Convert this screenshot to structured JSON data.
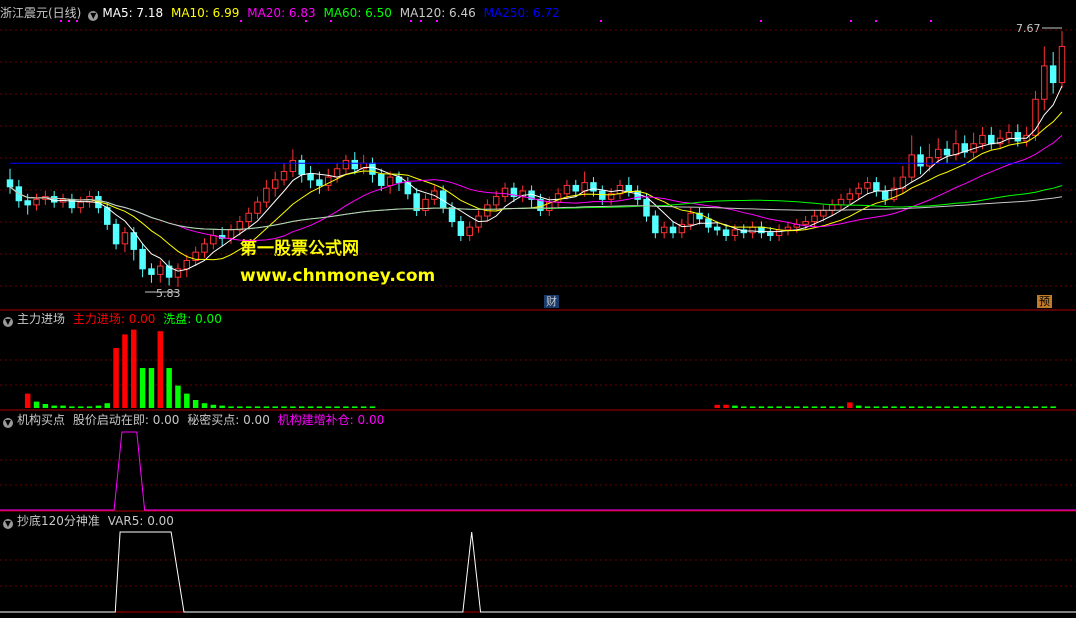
{
  "panel1": {
    "title": "浙江震元(日线)",
    "ma": [
      {
        "label": "MA5: 7.18",
        "color": "#ffffff"
      },
      {
        "label": "MA10: 6.99",
        "color": "#ffff00"
      },
      {
        "label": "MA20: 6.83",
        "color": "#ff00ff"
      },
      {
        "label": "MA60: 6.50",
        "color": "#00ff00"
      },
      {
        "label": "MA120: 6.46",
        "color": "#c8c8c8"
      },
      {
        "label": "MA250: 6.72",
        "color": "#0000ff"
      }
    ],
    "high_label": "7.67",
    "low_label": "5.83",
    "marker_cai": "财",
    "marker_yu": "预",
    "watermark_cn": "第一股票公式网",
    "watermark_url": "www.chnmoney.com"
  },
  "panel2": {
    "title": "主力进场",
    "v1_label": "主力进场: 0.00",
    "v2_label": "洗盘: 0.00",
    "v1_color": "#ff0000",
    "v2_color": "#00ff00"
  },
  "panel3": {
    "title": "机构买点",
    "l1": "股价启动在即: 0.00",
    "l2": "秘密买点: 0.00",
    "l3": "机构建增补仓: 0.00",
    "l3_color": "#ff00ff"
  },
  "panel4": {
    "title": "抄底120分神准",
    "l1": "VAR5: 0.00"
  },
  "chart_data": {
    "type": "candlestick",
    "y_range": [
      5.7,
      7.75
    ],
    "high": 7.67,
    "low": 5.83,
    "candles": [
      [
        6.6,
        6.55,
        6.68,
        6.5
      ],
      [
        6.55,
        6.45,
        6.6,
        6.4
      ],
      [
        6.45,
        6.42,
        6.5,
        6.35
      ],
      [
        6.42,
        6.46,
        6.5,
        6.38
      ],
      [
        6.46,
        6.48,
        6.52,
        6.42
      ],
      [
        6.48,
        6.44,
        6.52,
        6.4
      ],
      [
        6.44,
        6.46,
        6.5,
        6.4
      ],
      [
        6.46,
        6.4,
        6.5,
        6.36
      ],
      [
        6.4,
        6.44,
        6.48,
        6.36
      ],
      [
        6.44,
        6.48,
        6.52,
        6.4
      ],
      [
        6.48,
        6.4,
        6.52,
        6.36
      ],
      [
        6.4,
        6.28,
        6.44,
        6.24
      ],
      [
        6.28,
        6.14,
        6.32,
        6.1
      ],
      [
        6.14,
        6.22,
        6.26,
        6.08
      ],
      [
        6.22,
        6.1,
        6.26,
        6.02
      ],
      [
        6.1,
        5.96,
        6.14,
        5.9
      ],
      [
        5.96,
        5.92,
        6.0,
        5.86
      ],
      [
        5.92,
        5.98,
        6.02,
        5.86
      ],
      [
        5.98,
        5.9,
        6.02,
        5.84
      ],
      [
        5.9,
        5.96,
        6.0,
        5.83
      ],
      [
        5.96,
        6.02,
        6.06,
        5.9
      ],
      [
        6.02,
        6.08,
        6.12,
        5.98
      ],
      [
        6.08,
        6.14,
        6.18,
        6.04
      ],
      [
        6.14,
        6.2,
        6.24,
        6.1
      ],
      [
        6.2,
        6.18,
        6.26,
        6.12
      ],
      [
        6.18,
        6.24,
        6.28,
        6.14
      ],
      [
        6.24,
        6.3,
        6.34,
        6.2
      ],
      [
        6.3,
        6.36,
        6.4,
        6.26
      ],
      [
        6.36,
        6.44,
        6.48,
        6.32
      ],
      [
        6.44,
        6.54,
        6.6,
        6.4
      ],
      [
        6.54,
        6.6,
        6.66,
        6.48
      ],
      [
        6.6,
        6.66,
        6.72,
        6.56
      ],
      [
        6.66,
        6.74,
        6.82,
        6.62
      ],
      [
        6.74,
        6.64,
        6.78,
        6.58
      ],
      [
        6.64,
        6.6,
        6.7,
        6.54
      ],
      [
        6.6,
        6.56,
        6.66,
        6.5
      ],
      [
        6.56,
        6.62,
        6.68,
        6.52
      ],
      [
        6.62,
        6.68,
        6.72,
        6.58
      ],
      [
        6.68,
        6.74,
        6.78,
        6.64
      ],
      [
        6.74,
        6.68,
        6.8,
        6.64
      ],
      [
        6.68,
        6.72,
        6.78,
        6.64
      ],
      [
        6.72,
        6.64,
        6.76,
        6.58
      ],
      [
        6.64,
        6.56,
        6.68,
        6.52
      ],
      [
        6.56,
        6.62,
        6.66,
        6.5
      ],
      [
        6.62,
        6.58,
        6.66,
        6.52
      ],
      [
        6.58,
        6.5,
        6.62,
        6.46
      ],
      [
        6.5,
        6.38,
        6.54,
        6.34
      ],
      [
        6.38,
        6.46,
        6.5,
        6.34
      ],
      [
        6.46,
        6.52,
        6.56,
        6.42
      ],
      [
        6.52,
        6.4,
        6.56,
        6.36
      ],
      [
        6.4,
        6.3,
        6.44,
        6.26
      ],
      [
        6.3,
        6.2,
        6.34,
        6.16
      ],
      [
        6.2,
        6.26,
        6.3,
        6.16
      ],
      [
        6.26,
        6.34,
        6.38,
        6.22
      ],
      [
        6.34,
        6.42,
        6.46,
        6.3
      ],
      [
        6.42,
        6.48,
        6.52,
        6.38
      ],
      [
        6.48,
        6.54,
        6.58,
        6.44
      ],
      [
        6.54,
        6.48,
        6.58,
        6.44
      ],
      [
        6.48,
        6.52,
        6.56,
        6.44
      ],
      [
        6.52,
        6.46,
        6.56,
        6.4
      ],
      [
        6.46,
        6.38,
        6.5,
        6.34
      ],
      [
        6.38,
        6.44,
        6.48,
        6.34
      ],
      [
        6.44,
        6.5,
        6.54,
        6.4
      ],
      [
        6.5,
        6.56,
        6.6,
        6.46
      ],
      [
        6.56,
        6.52,
        6.6,
        6.48
      ],
      [
        6.52,
        6.58,
        6.66,
        6.48
      ],
      [
        6.58,
        6.52,
        6.62,
        6.48
      ],
      [
        6.52,
        6.46,
        6.56,
        6.42
      ],
      [
        6.46,
        6.5,
        6.54,
        6.42
      ],
      [
        6.5,
        6.56,
        6.6,
        6.46
      ],
      [
        6.56,
        6.52,
        6.62,
        6.48
      ],
      [
        6.52,
        6.46,
        6.56,
        6.42
      ],
      [
        6.46,
        6.34,
        6.5,
        6.3
      ],
      [
        6.34,
        6.22,
        6.38,
        6.18
      ],
      [
        6.22,
        6.26,
        6.3,
        6.18
      ],
      [
        6.26,
        6.22,
        6.3,
        6.18
      ],
      [
        6.22,
        6.28,
        6.32,
        6.18
      ],
      [
        6.28,
        6.36,
        6.4,
        6.24
      ],
      [
        6.36,
        6.32,
        6.4,
        6.28
      ],
      [
        6.32,
        6.26,
        6.36,
        6.22
      ],
      [
        6.26,
        6.24,
        6.3,
        6.2
      ],
      [
        6.24,
        6.2,
        6.28,
        6.16
      ],
      [
        6.2,
        6.24,
        6.28,
        6.16
      ],
      [
        6.24,
        6.22,
        6.28,
        6.18
      ],
      [
        6.22,
        6.26,
        6.3,
        6.18
      ],
      [
        6.26,
        6.22,
        6.3,
        6.18
      ],
      [
        6.22,
        6.2,
        6.26,
        6.16
      ],
      [
        6.2,
        6.24,
        6.28,
        6.16
      ],
      [
        6.24,
        6.26,
        6.3,
        6.2
      ],
      [
        6.26,
        6.28,
        6.32,
        6.22
      ],
      [
        6.28,
        6.3,
        6.34,
        6.24
      ],
      [
        6.3,
        6.34,
        6.38,
        6.26
      ],
      [
        6.34,
        6.38,
        6.42,
        6.3
      ],
      [
        6.38,
        6.42,
        6.46,
        6.34
      ],
      [
        6.42,
        6.46,
        6.5,
        6.38
      ],
      [
        6.46,
        6.5,
        6.54,
        6.42
      ],
      [
        6.5,
        6.54,
        6.58,
        6.46
      ],
      [
        6.54,
        6.58,
        6.62,
        6.5
      ],
      [
        6.58,
        6.52,
        6.62,
        6.48
      ],
      [
        6.52,
        6.46,
        6.56,
        6.42
      ],
      [
        6.46,
        6.54,
        6.62,
        6.44
      ],
      [
        6.54,
        6.62,
        6.7,
        6.5
      ],
      [
        6.62,
        6.78,
        6.92,
        6.58
      ],
      [
        6.78,
        6.7,
        6.84,
        6.64
      ],
      [
        6.7,
        6.76,
        6.86,
        6.66
      ],
      [
        6.76,
        6.82,
        6.9,
        6.72
      ],
      [
        6.82,
        6.78,
        6.88,
        6.72
      ],
      [
        6.78,
        6.86,
        6.96,
        6.74
      ],
      [
        6.86,
        6.8,
        6.92,
        6.76
      ],
      [
        6.8,
        6.86,
        6.94,
        6.76
      ],
      [
        6.86,
        6.92,
        6.98,
        6.82
      ],
      [
        6.92,
        6.86,
        6.98,
        6.82
      ],
      [
        6.86,
        6.9,
        6.96,
        6.82
      ],
      [
        6.9,
        6.94,
        7.0,
        6.86
      ],
      [
        6.94,
        6.88,
        7.0,
        6.84
      ],
      [
        6.88,
        6.92,
        6.98,
        6.84
      ],
      [
        6.92,
        7.18,
        7.24,
        6.88
      ],
      [
        7.18,
        7.42,
        7.56,
        7.1
      ],
      [
        7.42,
        7.3,
        7.52,
        7.22
      ],
      [
        7.3,
        7.56,
        7.67,
        7.26
      ]
    ],
    "panel2_bars": [
      {
        "i": 2,
        "v": 0.18,
        "c": "red"
      },
      {
        "i": 3,
        "v": 0.08,
        "c": "green"
      },
      {
        "i": 4,
        "v": 0.05,
        "c": "green"
      },
      {
        "i": 5,
        "v": 0.03,
        "c": "green"
      },
      {
        "i": 6,
        "v": 0.03,
        "c": "green"
      },
      {
        "i": 7,
        "v": 0.02,
        "c": "green"
      },
      {
        "i": 8,
        "v": 0.02,
        "c": "green"
      },
      {
        "i": 9,
        "v": 0.02,
        "c": "green"
      },
      {
        "i": 10,
        "v": 0.03,
        "c": "green"
      },
      {
        "i": 11,
        "v": 0.06,
        "c": "green"
      },
      {
        "i": 12,
        "v": 0.75,
        "c": "red"
      },
      {
        "i": 13,
        "v": 0.92,
        "c": "red"
      },
      {
        "i": 14,
        "v": 0.98,
        "c": "red"
      },
      {
        "i": 15,
        "v": 0.5,
        "c": "green"
      },
      {
        "i": 16,
        "v": 0.5,
        "c": "green"
      },
      {
        "i": 17,
        "v": 0.96,
        "c": "red"
      },
      {
        "i": 18,
        "v": 0.5,
        "c": "green"
      },
      {
        "i": 19,
        "v": 0.28,
        "c": "green"
      },
      {
        "i": 20,
        "v": 0.18,
        "c": "green"
      },
      {
        "i": 21,
        "v": 0.1,
        "c": "green"
      },
      {
        "i": 22,
        "v": 0.06,
        "c": "green"
      },
      {
        "i": 23,
        "v": 0.04,
        "c": "green"
      },
      {
        "i": 24,
        "v": 0.03,
        "c": "green"
      },
      {
        "i": 25,
        "v": 0.02,
        "c": "green"
      },
      {
        "i": 26,
        "v": 0.02,
        "c": "green"
      },
      {
        "i": 27,
        "v": 0.02,
        "c": "green"
      },
      {
        "i": 28,
        "v": 0.02,
        "c": "green"
      },
      {
        "i": 29,
        "v": 0.02,
        "c": "green"
      },
      {
        "i": 30,
        "v": 0.02,
        "c": "green"
      },
      {
        "i": 31,
        "v": 0.02,
        "c": "green"
      },
      {
        "i": 32,
        "v": 0.02,
        "c": "green"
      },
      {
        "i": 33,
        "v": 0.02,
        "c": "green"
      },
      {
        "i": 34,
        "v": 0.02,
        "c": "green"
      },
      {
        "i": 35,
        "v": 0.02,
        "c": "green"
      },
      {
        "i": 36,
        "v": 0.02,
        "c": "green"
      },
      {
        "i": 37,
        "v": 0.02,
        "c": "green"
      },
      {
        "i": 38,
        "v": 0.02,
        "c": "green"
      },
      {
        "i": 39,
        "v": 0.02,
        "c": "green"
      },
      {
        "i": 40,
        "v": 0.02,
        "c": "green"
      },
      {
        "i": 41,
        "v": 0.02,
        "c": "green"
      },
      {
        "i": 80,
        "v": 0.04,
        "c": "red"
      },
      {
        "i": 81,
        "v": 0.04,
        "c": "red"
      },
      {
        "i": 82,
        "v": 0.03,
        "c": "green"
      },
      {
        "i": 83,
        "v": 0.02,
        "c": "green"
      },
      {
        "i": 84,
        "v": 0.02,
        "c": "green"
      },
      {
        "i": 85,
        "v": 0.02,
        "c": "green"
      },
      {
        "i": 86,
        "v": 0.02,
        "c": "green"
      },
      {
        "i": 87,
        "v": 0.02,
        "c": "green"
      },
      {
        "i": 88,
        "v": 0.02,
        "c": "green"
      },
      {
        "i": 89,
        "v": 0.02,
        "c": "green"
      },
      {
        "i": 90,
        "v": 0.02,
        "c": "green"
      },
      {
        "i": 91,
        "v": 0.02,
        "c": "green"
      },
      {
        "i": 92,
        "v": 0.02,
        "c": "green"
      },
      {
        "i": 93,
        "v": 0.02,
        "c": "green"
      },
      {
        "i": 94,
        "v": 0.02,
        "c": "green"
      },
      {
        "i": 95,
        "v": 0.07,
        "c": "red"
      },
      {
        "i": 96,
        "v": 0.03,
        "c": "green"
      },
      {
        "i": 97,
        "v": 0.02,
        "c": "green"
      },
      {
        "i": 98,
        "v": 0.02,
        "c": "green"
      },
      {
        "i": 99,
        "v": 0.02,
        "c": "green"
      },
      {
        "i": 100,
        "v": 0.02,
        "c": "green"
      },
      {
        "i": 101,
        "v": 0.02,
        "c": "green"
      },
      {
        "i": 102,
        "v": 0.02,
        "c": "green"
      },
      {
        "i": 103,
        "v": 0.02,
        "c": "green"
      },
      {
        "i": 104,
        "v": 0.02,
        "c": "green"
      },
      {
        "i": 105,
        "v": 0.02,
        "c": "green"
      },
      {
        "i": 106,
        "v": 0.02,
        "c": "green"
      },
      {
        "i": 107,
        "v": 0.02,
        "c": "green"
      },
      {
        "i": 108,
        "v": 0.02,
        "c": "green"
      },
      {
        "i": 109,
        "v": 0.02,
        "c": "green"
      },
      {
        "i": 110,
        "v": 0.02,
        "c": "green"
      },
      {
        "i": 111,
        "v": 0.02,
        "c": "green"
      },
      {
        "i": 112,
        "v": 0.02,
        "c": "green"
      },
      {
        "i": 113,
        "v": 0.02,
        "c": "green"
      },
      {
        "i": 114,
        "v": 0.02,
        "c": "green"
      },
      {
        "i": 115,
        "v": 0.02,
        "c": "green"
      },
      {
        "i": 116,
        "v": 0.02,
        "c": "green"
      },
      {
        "i": 117,
        "v": 0.02,
        "c": "green"
      },
      {
        "i": 118,
        "v": 0.02,
        "c": "green"
      }
    ]
  }
}
